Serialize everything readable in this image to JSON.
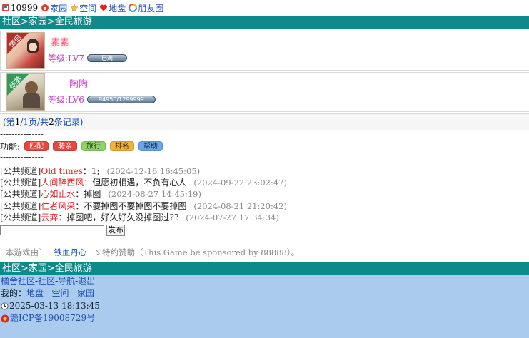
{
  "topnav": {
    "count": "10999",
    "items": [
      {
        "label": "家园"
      },
      {
        "label": "空间"
      },
      {
        "label": "地盘"
      },
      {
        "label": "朋友圈"
      }
    ]
  },
  "breadcrumb": {
    "text": "社区>家园>全民旅游"
  },
  "members": [
    {
      "badge": "情侣",
      "name": "素素",
      "level": "等级:LV7",
      "progress": "已满"
    },
    {
      "badge": "徒弟",
      "name": "陶陶",
      "level": "等级:LV6",
      "progress": "94950/1299999"
    }
  ],
  "pager": {
    "prefix": "(第",
    "page": "1",
    "mid": "/1页/共",
    "count": "2",
    "suffix": "条记录)"
  },
  "separator": "---------------",
  "functions": {
    "label": "功能:",
    "buttons": [
      {
        "label": "匹配",
        "bg": "#e8473f",
        "fg": "#ffffff"
      },
      {
        "label": "聘亲",
        "bg": "#e8473f",
        "fg": "#ffffff"
      },
      {
        "label": "旅行",
        "bg": "#8fd46a",
        "fg": "#1a3a10"
      },
      {
        "label": "排名",
        "bg": "#f2b33d",
        "fg": "#3a2a00"
      },
      {
        "label": "帮助",
        "bg": "#6aa8e8",
        "fg": "#0f2a4a"
      }
    ]
  },
  "messages": [
    {
      "channel": "[公共频道]",
      "who": "Old times",
      "text": "：1;",
      "time": "(2024-12-16 16:45:05)"
    },
    {
      "channel": "[公共频道]",
      "who": "人间醉西风",
      "text": "：但愿初相遇，不负有心人",
      "time": "(2024-09-22 23:02:47)"
    },
    {
      "channel": "[公共频道]",
      "who": "心如止水",
      "text": "：掉图",
      "time": "(2024-08-27 14:45:19)"
    },
    {
      "channel": "[公共频道]",
      "who": "仁者风采",
      "text": "：不要掉图不要掉图不要掉图",
      "time": "(2024-08-21 21:20:42)"
    },
    {
      "channel": "[公共频道]",
      "who": "云弈",
      "text": "：掉图吧，好久好久没掉图过??",
      "time": "(2024-07-27 17:34:34)"
    }
  ],
  "post": {
    "value": "",
    "button": "发布"
  },
  "credits": {
    "prefix": "本游戏由゜",
    "link": "铁血丹心",
    "suffix": "ゞ特约赞助（This Game be sponsored by 88888）。"
  },
  "footer": {
    "nav": [
      {
        "label": "橘舍社区"
      },
      {
        "label": "-"
      },
      {
        "label": "社区"
      },
      {
        "label": "-"
      },
      {
        "label": "导航"
      },
      {
        "label": "-"
      },
      {
        "label": "退出"
      }
    ],
    "mine_label": "我的：",
    "mine_links": [
      {
        "label": "地盘"
      },
      {
        "label": "空间"
      },
      {
        "label": "家园"
      }
    ],
    "datetime": "2025-03-13 18:13:45",
    "icp": "赣ICP备19008729号"
  }
}
